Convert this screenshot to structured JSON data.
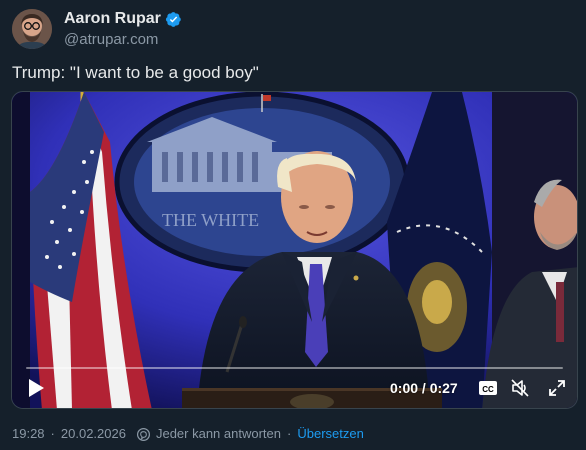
{
  "author": {
    "display_name": "Aaron Rupar",
    "handle": "@atrupar.com",
    "avatar_icon": "avatar-glasses-beard",
    "verified_icon": "verified-badge-icon",
    "verified_color": "#1d9bf0"
  },
  "tweet": {
    "text": "Trump: \"I want to be a good boy\""
  },
  "video": {
    "timecode": "0:00 / 0:27",
    "progress": 0,
    "controls": {
      "play_icon": "play-icon",
      "cc_label": "CC",
      "mute_icon": "muted-speaker-icon",
      "fullscreen_icon": "fullscreen-icon"
    },
    "backdrop_text": "THE WHITE"
  },
  "meta": {
    "time": "19:28",
    "date": "20.02.2026",
    "separator": "·",
    "reply_setting": "Jeder kann antworten",
    "translate_label": "Übersetzen",
    "link_color": "#1d9bf0",
    "muted_color": "#8b98a5"
  }
}
